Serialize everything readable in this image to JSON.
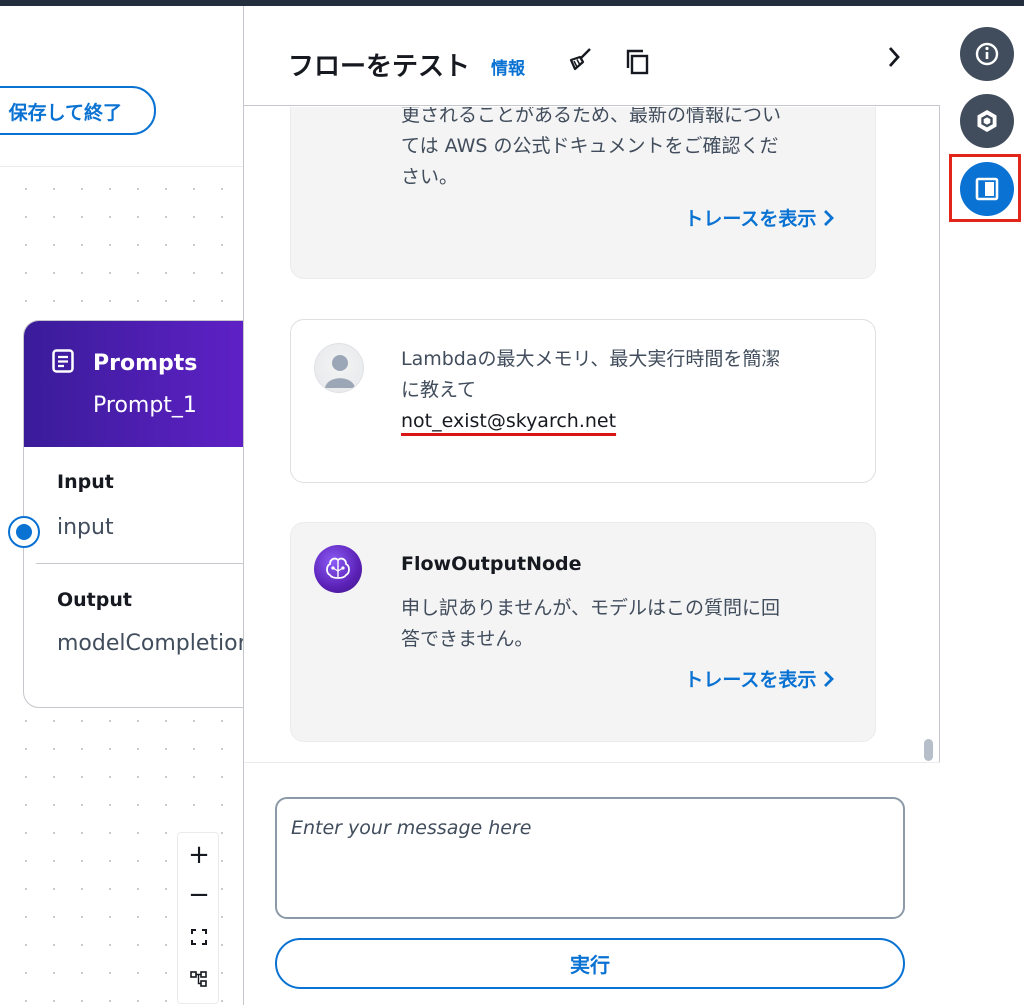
{
  "canvas": {
    "save_exit_label": "保存して終了",
    "node": {
      "type": "Prompts",
      "name": "Prompt_1",
      "input_label": "Input",
      "input_value": "input",
      "output_label": "Output",
      "output_value": "modelCompletion"
    },
    "zoom": {
      "in": "+",
      "out": "−"
    }
  },
  "panel": {
    "title": "フローをテスト",
    "info": "情報",
    "messages": [
      {
        "role": "bot",
        "lines": [
          "更されることがあるため、最新の情報につい",
          "ては AWS の公式ドキュメントをご確認くだ",
          "さい。"
        ],
        "trace": "トレースを表示"
      },
      {
        "role": "user",
        "lines": [
          "Lambdaの最大メモリ、最大実行時間を簡潔",
          "に教えて"
        ],
        "email": "not_exist@skyarch.net"
      },
      {
        "role": "bot",
        "sender": "FlowOutputNode",
        "lines": [
          "申し訳ありませんが、モデルはこの質問に回",
          "答できません。"
        ],
        "trace": "トレースを表示"
      }
    ],
    "composer": {
      "placeholder": "Enter your message here",
      "run_label": "実行"
    }
  },
  "rail": {
    "icons": [
      "info-icon",
      "node-hexagon-icon",
      "panel-toggle-icon"
    ]
  },
  "colors": {
    "accent": "#0972d3",
    "rail_dark": "#414d5c",
    "node_header_start": "#3a1c99",
    "node_header_end": "#6121c9",
    "highlight": "#e1251b"
  }
}
